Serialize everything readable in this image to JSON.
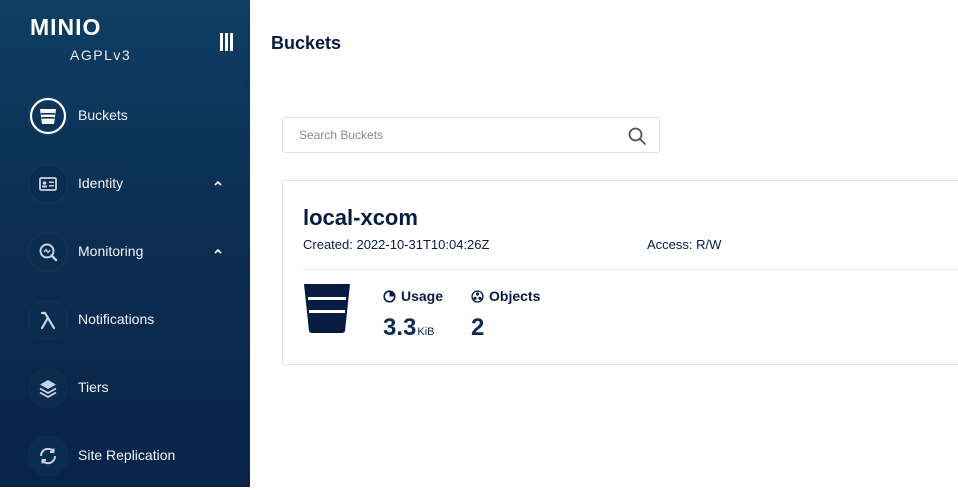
{
  "sidebar": {
    "logo": "MINIO",
    "edition": "AGPLv3",
    "items": [
      {
        "label": "Buckets",
        "icon": "bucket-icon",
        "active": true
      },
      {
        "label": "Identity",
        "icon": "id-card-icon",
        "expandable": true
      },
      {
        "label": "Monitoring",
        "icon": "monitoring-icon",
        "expandable": true
      },
      {
        "label": "Notifications",
        "icon": "lambda-icon"
      },
      {
        "label": "Tiers",
        "icon": "layers-icon"
      },
      {
        "label": "Site Replication",
        "icon": "replication-icon"
      }
    ]
  },
  "header": {
    "title": "Buckets"
  },
  "search": {
    "placeholder": "Search Buckets",
    "value": ""
  },
  "buckets": [
    {
      "name": "local-xcom",
      "created": "Created: 2022-10-31T10:04:26Z",
      "access": "Access: R/W",
      "usage_label": "Usage",
      "usage_value": "3.3",
      "usage_unit": "KiB",
      "objects_label": "Objects",
      "objects_value": "2"
    }
  ],
  "colors": {
    "sidebar": "#0b2e52",
    "text": "#081c42",
    "accent": "#0b2a55"
  }
}
